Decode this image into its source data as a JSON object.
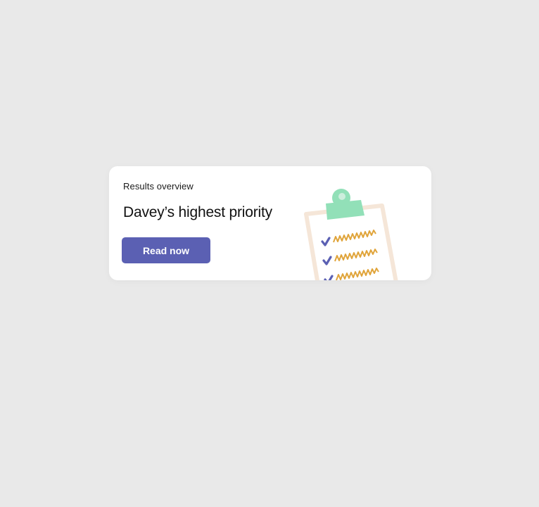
{
  "card": {
    "eyebrow": "Results overview",
    "headline": "Davey’s highest priority",
    "button_label": "Read now"
  },
  "illustration": {
    "icon": "clipboard-checklist-icon",
    "checklist_items": 3
  },
  "colors": {
    "page_background": "#e9e9e9",
    "card_background": "#ffffff",
    "button": "#5b60b3",
    "button_text": "#ffffff",
    "clip": "#92e0b8",
    "board_border": "#f5e6d8",
    "check": "#5b60b3",
    "scribble": "#e0a43a"
  }
}
